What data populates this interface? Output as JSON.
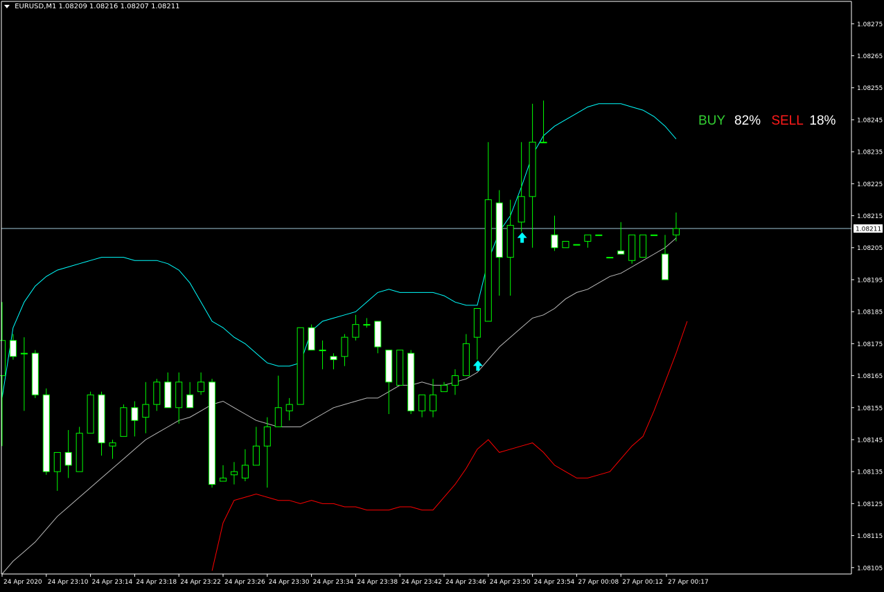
{
  "header": {
    "symbol": "EURUSD,M1",
    "ohlc": "1.08209 1.08216 1.08207 1.08211"
  },
  "signal": {
    "buy_label": "BUY",
    "buy_pct": "82%",
    "sell_label": "SELL",
    "sell_pct": "18%"
  },
  "colors": {
    "background": "#000000",
    "bull_candle": "#00ff00",
    "bear_body": "#ffffff",
    "upper_band": "#00ffff",
    "middle_band": "#bbbbbb",
    "lower_band": "#ff0000",
    "arrow": "#00ffff",
    "axis": "#ffffff",
    "price_line": "#a0c8d8"
  },
  "chart_data": {
    "type": "candlestick",
    "title": "",
    "xlabel": "",
    "ylabel": "",
    "ylim": [
      1.08103,
      1.08282
    ],
    "y_ticks": [
      "1.08275",
      "1.08265",
      "1.08255",
      "1.08245",
      "1.08235",
      "1.08225",
      "1.08215",
      "1.08205",
      "1.08195",
      "1.08185",
      "1.08175",
      "1.08165",
      "1.08155",
      "1.08145",
      "1.08135",
      "1.08125",
      "1.08115",
      "1.08105"
    ],
    "x_ticks": [
      "24 Apr 2020",
      "24 Apr 23:10",
      "24 Apr 23:14",
      "24 Apr 23:18",
      "24 Apr 23:22",
      "24 Apr 23:26",
      "24 Apr 23:30",
      "24 Apr 23:34",
      "24 Apr 23:38",
      "24 Apr 23:42",
      "24 Apr 23:46",
      "24 Apr 23:50",
      "24 Apr 23:54",
      "27 Apr 00:08",
      "27 Apr 00:12",
      "27 Apr 00:17"
    ],
    "current_price": "1.08211",
    "candles": [
      {
        "o": 1.08165,
        "h": 1.08188,
        "l": 1.08143,
        "c": 1.08176
      },
      {
        "o": 1.08176,
        "h": 1.08178,
        "l": 1.0817,
        "c": 1.08171
      },
      {
        "o": 1.08172,
        "h": 1.08177,
        "l": 1.08154,
        "c": 1.08172
      },
      {
        "o": 1.08172,
        "h": 1.08173,
        "l": 1.08158,
        "c": 1.08159
      },
      {
        "o": 1.08159,
        "h": 1.08161,
        "l": 1.08134,
        "c": 1.08135
      },
      {
        "o": 1.08135,
        "h": 1.08141,
        "l": 1.08129,
        "c": 1.08141
      },
      {
        "o": 1.08141,
        "h": 1.08148,
        "l": 1.08133,
        "c": 1.08137
      },
      {
        "o": 1.08135,
        "h": 1.08149,
        "l": 1.08135,
        "c": 1.08147
      },
      {
        "o": 1.08147,
        "h": 1.0816,
        "l": 1.08147,
        "c": 1.08159
      },
      {
        "o": 1.08159,
        "h": 1.0816,
        "l": 1.0814,
        "c": 1.08144
      },
      {
        "o": 1.08143,
        "h": 1.08145,
        "l": 1.08139,
        "c": 1.08144
      },
      {
        "o": 1.08146,
        "h": 1.08156,
        "l": 1.08146,
        "c": 1.08155
      },
      {
        "o": 1.08155,
        "h": 1.08157,
        "l": 1.08146,
        "c": 1.08151
      },
      {
        "o": 1.08152,
        "h": 1.08163,
        "l": 1.08147,
        "c": 1.08156
      },
      {
        "o": 1.08156,
        "h": 1.08164,
        "l": 1.08154,
        "c": 1.08163
      },
      {
        "o": 1.08163,
        "h": 1.08166,
        "l": 1.08155,
        "c": 1.08155
      },
      {
        "o": 1.08155,
        "h": 1.08166,
        "l": 1.0815,
        "c": 1.08163
      },
      {
        "o": 1.08159,
        "h": 1.08163,
        "l": 1.08155,
        "c": 1.08155
      },
      {
        "o": 1.0816,
        "h": 1.08166,
        "l": 1.08159,
        "c": 1.08163
      },
      {
        "o": 1.08163,
        "h": 1.08164,
        "l": 1.0813,
        "c": 1.08131
      },
      {
        "o": 1.08132,
        "h": 1.08137,
        "l": 1.08132,
        "c": 1.08133
      },
      {
        "o": 1.08134,
        "h": 1.08138,
        "l": 1.08131,
        "c": 1.08135
      },
      {
        "o": 1.08133,
        "h": 1.08142,
        "l": 1.08132,
        "c": 1.08137
      },
      {
        "o": 1.08137,
        "h": 1.08149,
        "l": 1.08137,
        "c": 1.08143
      },
      {
        "o": 1.08143,
        "h": 1.08152,
        "l": 1.0813,
        "c": 1.08149
      },
      {
        "o": 1.08149,
        "h": 1.08165,
        "l": 1.08149,
        "c": 1.08155
      },
      {
        "o": 1.08154,
        "h": 1.08158,
        "l": 1.08151,
        "c": 1.08156
      },
      {
        "o": 1.08156,
        "h": 1.0818,
        "l": 1.08156,
        "c": 1.0818
      },
      {
        "o": 1.0818,
        "h": 1.08181,
        "l": 1.08173,
        "c": 1.08173
      },
      {
        "o": 1.08173,
        "h": 1.08176,
        "l": 1.08167,
        "c": 1.08173
      },
      {
        "o": 1.08171,
        "h": 1.08172,
        "l": 1.08167,
        "c": 1.0817
      },
      {
        "o": 1.08171,
        "h": 1.08178,
        "l": 1.08168,
        "c": 1.08177
      },
      {
        "o": 1.08177,
        "h": 1.08184,
        "l": 1.08176,
        "c": 1.08181
      },
      {
        "o": 1.08181,
        "h": 1.08183,
        "l": 1.0818,
        "c": 1.08181
      },
      {
        "o": 1.08182,
        "h": 1.08182,
        "l": 1.08172,
        "c": 1.08174
      },
      {
        "o": 1.08173,
        "h": 1.08173,
        "l": 1.08153,
        "c": 1.08163
      },
      {
        "o": 1.08162,
        "h": 1.08173,
        "l": 1.08162,
        "c": 1.08173
      },
      {
        "o": 1.08172,
        "h": 1.08173,
        "l": 1.08153,
        "c": 1.08154
      },
      {
        "o": 1.08154,
        "h": 1.08159,
        "l": 1.08152,
        "c": 1.08159
      },
      {
        "o": 1.08154,
        "h": 1.08164,
        "l": 1.08152,
        "c": 1.08159
      },
      {
        "o": 1.0816,
        "h": 1.08163,
        "l": 1.0816,
        "c": 1.08162
      },
      {
        "o": 1.08162,
        "h": 1.08167,
        "l": 1.08159,
        "c": 1.08165
      },
      {
        "o": 1.08165,
        "h": 1.08178,
        "l": 1.08165,
        "c": 1.08175
      },
      {
        "o": 1.08177,
        "h": 1.08185,
        "l": 1.0817,
        "c": 1.08186
      },
      {
        "o": 1.08182,
        "h": 1.08238,
        "l": 1.08182,
        "c": 1.0822
      },
      {
        "o": 1.08219,
        "h": 1.08223,
        "l": 1.0819,
        "c": 1.08202
      },
      {
        "o": 1.08202,
        "h": 1.0822,
        "l": 1.0819,
        "c": 1.08212
      },
      {
        "o": 1.08213,
        "h": 1.08238,
        "l": 1.0821,
        "c": 1.08221
      },
      {
        "o": 1.08221,
        "h": 1.0825,
        "l": 1.08205,
        "c": 1.08238
      },
      {
        "o": 1.08238,
        "h": 1.08251,
        "l": 1.08238,
        "c": 1.08238
      },
      {
        "o": 1.08209,
        "h": 1.08215,
        "l": 1.08204,
        "c": 1.08205
      },
      {
        "o": 1.08205,
        "h": 1.08207,
        "l": 1.08205,
        "c": 1.08207
      },
      {
        "o": 1.08206,
        "h": 1.08206,
        "l": 1.08206,
        "c": 1.08206
      },
      {
        "o": 1.08207,
        "h": 1.08209,
        "l": 1.08205,
        "c": 1.08209
      },
      {
        "o": 1.08209,
        "h": 1.08209,
        "l": 1.08209,
        "c": 1.08209
      },
      {
        "o": 1.08202,
        "h": 1.08202,
        "l": 1.08202,
        "c": 1.08202
      },
      {
        "o": 1.08204,
        "h": 1.08213,
        "l": 1.08203,
        "c": 1.08203
      },
      {
        "o": 1.08201,
        "h": 1.08209,
        "l": 1.082,
        "c": 1.08209
      },
      {
        "o": 1.08202,
        "h": 1.08209,
        "l": 1.08202,
        "c": 1.08209
      },
      {
        "o": 1.08209,
        "h": 1.08209,
        "l": 1.08209,
        "c": 1.08209
      },
      {
        "o": 1.08203,
        "h": 1.08209,
        "l": 1.08195,
        "c": 1.08195
      },
      {
        "o": 1.08209,
        "h": 1.08216,
        "l": 1.08207,
        "c": 1.08211
      }
    ],
    "arrow_bars": [
      43,
      47
    ],
    "series": [
      {
        "key": "upper",
        "values": [
          1.08158,
          1.0818,
          1.08188,
          1.08193,
          1.08196,
          1.08198,
          1.08199,
          1.082,
          1.08201,
          1.08202,
          1.08202,
          1.08202,
          1.08201,
          1.08201,
          1.08201,
          1.082,
          1.08198,
          1.08194,
          1.08188,
          1.08182,
          1.0818,
          1.08177,
          1.08175,
          1.08172,
          1.08169,
          1.08168,
          1.08168,
          1.08169,
          1.08179,
          1.08182,
          1.08183,
          1.08184,
          1.08185,
          1.08188,
          1.08191,
          1.08192,
          1.08191,
          1.08191,
          1.08191,
          1.08191,
          1.0819,
          1.08188,
          1.08187,
          1.08187,
          1.08201,
          1.0821,
          1.08215,
          1.08224,
          1.08234,
          1.0824,
          1.08243,
          1.08245,
          1.08247,
          1.08249,
          1.0825,
          1.0825,
          1.0825,
          1.08249,
          1.08248,
          1.08246,
          1.08243,
          1.08239
        ]
      },
      {
        "key": "middle",
        "values": [
          1.08103,
          1.08107,
          1.0811,
          1.08113,
          1.08117,
          1.08121,
          1.08124,
          1.08127,
          1.0813,
          1.08133,
          1.08136,
          1.08139,
          1.08142,
          1.08145,
          1.08147,
          1.08149,
          1.08151,
          1.08152,
          1.08154,
          1.08156,
          1.08157,
          1.08155,
          1.08153,
          1.08151,
          1.0815,
          1.08149,
          1.08149,
          1.08149,
          1.08151,
          1.08153,
          1.08155,
          1.08156,
          1.08157,
          1.08158,
          1.08158,
          1.0816,
          1.08162,
          1.08162,
          1.08163,
          1.08162,
          1.08162,
          1.08163,
          1.08164,
          1.08166,
          1.0817,
          1.08174,
          1.08177,
          1.0818,
          1.08183,
          1.08184,
          1.08186,
          1.08189,
          1.08191,
          1.08192,
          1.08194,
          1.08196,
          1.08197,
          1.08199,
          1.08201,
          1.08203,
          1.08205,
          1.08208
        ]
      },
      {
        "key": "lower",
        "values": [
          null,
          null,
          null,
          null,
          null,
          null,
          null,
          null,
          null,
          null,
          null,
          null,
          null,
          null,
          null,
          null,
          null,
          null,
          null,
          1.08104,
          1.08119,
          1.08126,
          1.08127,
          1.08128,
          1.08127,
          1.08126,
          1.08126,
          1.08125,
          1.08126,
          1.08125,
          1.08125,
          1.08124,
          1.08124,
          1.08123,
          1.08123,
          1.08123,
          1.08124,
          1.08124,
          1.08123,
          1.08123,
          1.08127,
          1.08131,
          1.08136,
          1.08142,
          1.08145,
          1.08141,
          1.08142,
          1.08143,
          1.08144,
          1.08141,
          1.08137,
          1.08135,
          1.08133,
          1.08133,
          1.08134,
          1.08135,
          1.08139,
          1.08143,
          1.08146,
          1.08154,
          1.08163,
          1.08172,
          1.08182
        ]
      }
    ]
  }
}
